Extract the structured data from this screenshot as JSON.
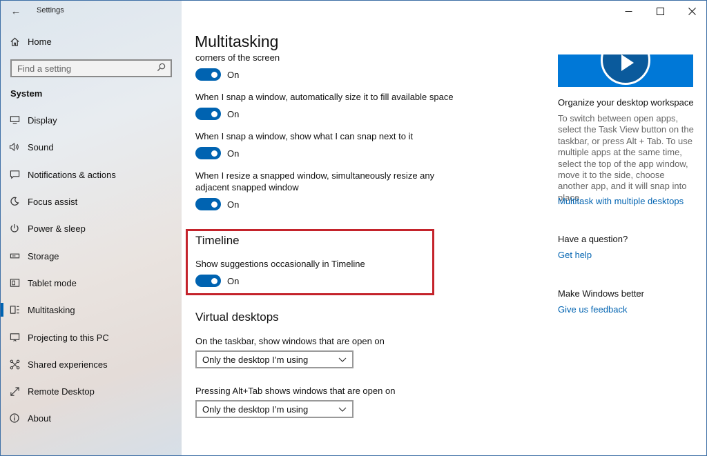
{
  "app": {
    "title": "Settings",
    "back_glyph": "←"
  },
  "window_controls": {
    "minimize": "─",
    "maximize": "☐",
    "close": "✕"
  },
  "sidebar": {
    "home": "Home",
    "search_placeholder": "Find a setting",
    "group": "System",
    "items": [
      {
        "label": "Display",
        "icon": "display-icon"
      },
      {
        "label": "Sound",
        "icon": "sound-icon"
      },
      {
        "label": "Notifications & actions",
        "icon": "notifications-icon"
      },
      {
        "label": "Focus assist",
        "icon": "focus-assist-icon"
      },
      {
        "label": "Power & sleep",
        "icon": "power-icon"
      },
      {
        "label": "Storage",
        "icon": "storage-icon"
      },
      {
        "label": "Tablet mode",
        "icon": "tablet-icon"
      },
      {
        "label": "Multitasking",
        "icon": "multitasking-icon",
        "selected": true
      },
      {
        "label": "Projecting to this PC",
        "icon": "projecting-icon"
      },
      {
        "label": "Shared experiences",
        "icon": "shared-icon"
      },
      {
        "label": "Remote Desktop",
        "icon": "remote-desktop-icon"
      },
      {
        "label": "About",
        "icon": "info-icon"
      }
    ]
  },
  "main": {
    "title": "Multitasking",
    "snap": {
      "partial_text": "corners of the screen",
      "settings": [
        {
          "description": "",
          "state": "On"
        },
        {
          "description": "When I snap a window, automatically size it to fill available space",
          "state": "On"
        },
        {
          "description": "When I snap a window, show what I can snap next to it",
          "state": "On"
        },
        {
          "description_line1": "When I resize a snapped window, simultaneously resize any",
          "description_line2": "adjacent snapped window",
          "state": "On"
        }
      ]
    },
    "timeline": {
      "title": "Timeline",
      "description": "Show suggestions occasionally in Timeline",
      "state": "On"
    },
    "virtual_desktops": {
      "title": "Virtual desktops",
      "taskbar_label": "On the taskbar, show windows that are open on",
      "taskbar_value": "Only the desktop I’m using",
      "alttab_label": "Pressing Alt+Tab shows windows that are open on",
      "alttab_value": "Only the desktop I’m using"
    }
  },
  "right": {
    "heading": "Organize your desktop workspace",
    "paragraph": "To switch between open apps, select the Task View button on the taskbar, or press Alt + Tab. To use multiple apps at the same time, select the top of the app window, move it to the side, choose another app, and it will snap into place.",
    "link_multitask": "Multitask with multiple desktops",
    "question_head": "Have a question?",
    "link_help": "Get help",
    "better_head": "Make Windows better",
    "link_feedback": "Give us feedback"
  },
  "colors": {
    "accent": "#0063b1",
    "highlight": "#c4232b",
    "video": "#0078d7"
  }
}
